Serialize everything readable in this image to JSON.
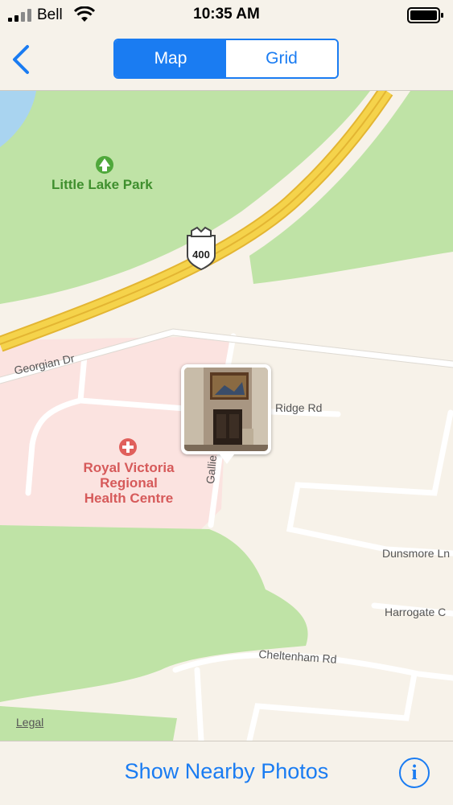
{
  "status_bar": {
    "carrier": "Bell",
    "time": "10:35 AM"
  },
  "nav": {
    "back_icon": "chevron-left-icon",
    "segments": [
      {
        "label": "Map",
        "selected": true
      },
      {
        "label": "Grid",
        "selected": false
      }
    ],
    "accent_color": "#1a7cf2"
  },
  "map": {
    "park_label": "Little Lake Park",
    "highway_shield": "400",
    "hospital_label": "Royal Victoria Regional Health Centre",
    "streets": {
      "georgian": "Georgian Dr",
      "ridge": "Ridge Rd",
      "gallie": "Gallie",
      "dunsmore": "Dunsmore Ln",
      "harrogate": "Harrogate C",
      "cheltenham": "Cheltenham Rd"
    },
    "legal": "Legal",
    "colors": {
      "park": "#bfe3a6",
      "hospital": "#fbe3e0",
      "land": "#f7f2e9",
      "highway": "#f5d34b",
      "water": "#a9d4f0"
    }
  },
  "toolbar": {
    "show_nearby": "Show Nearby Photos",
    "info_icon": "info-icon"
  }
}
